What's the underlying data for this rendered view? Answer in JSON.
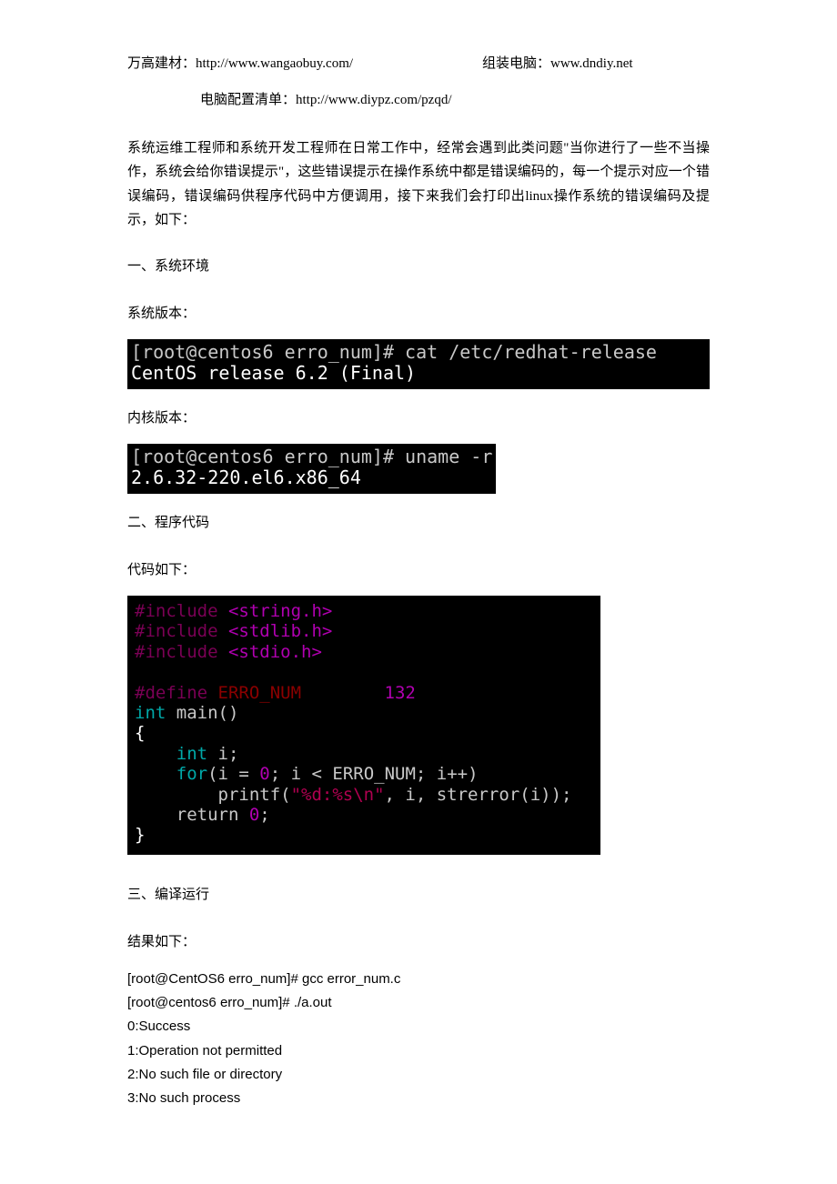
{
  "header": {
    "left": "万高建材：http://www.wangaobuy.com/",
    "right": "组装电脑：www.dndiy.net",
    "center": "电脑配置清单：http://www.diypz.com/pzqd/"
  },
  "intro": "系统运维工程师和系统开发工程师在日常工作中，经常会遇到此类问题\"当你进行了一些不当操作，系统会给你错误提示\"，这些错误提示在操作系统中都是错误编码的，每一个提示对应一个错误编码，错误编码供程序代码中方便调用，接下来我们会打印出linux操作系统的错误编码及提示，如下：",
  "sections": {
    "env": {
      "title": "一、系统环境",
      "sysVersion": "系统版本：",
      "kernelVersion": "内核版本："
    },
    "code": {
      "title": "二、程序代码",
      "label": "代码如下："
    },
    "compile": {
      "title": "三、编译运行",
      "label": "结果如下："
    }
  },
  "terminal1": {
    "line1": "[root@centos6 erro_num]# cat /etc/redhat-release",
    "line2": "CentOS release 6.2 (Final)"
  },
  "terminal2": {
    "line1": "[root@centos6 erro_num]# uname -r",
    "line2": "2.6.32-220.el6.x86_64"
  },
  "c_code": {
    "inc1": "#include",
    "h1": " <string.h>",
    "inc2": "#include",
    "h2": " <stdlib.h>",
    "inc3": "#include",
    "h3": " <stdio.h>",
    "def": "#define ",
    "macro": "ERRO_NUM",
    "macroval": "132",
    "int": "int",
    "main": " main()",
    "lbrace": "{",
    "int2": "int",
    "ivar": " i;",
    "for": "for",
    "forexpr": "(i = ",
    "zero1": "0",
    "forexpr2": "; i < ERRO_NUM; i++)",
    "printf": "printf(",
    "fmtstr": "\"%d:%s\\n\"",
    "printfargs": ", i, strerror(i));",
    "return": "return ",
    "zero2": "0",
    "semi": ";",
    "rbrace": "}"
  },
  "output": {
    "l1": "[root@CentOS6 erro_num]# gcc error_num.c",
    "l2": "[root@centos6 erro_num]# ./a.out",
    "l3": "0:Success",
    "l4": "1:Operation not permitted",
    "l5": "2:No such file or directory",
    "l6": "3:No such process"
  }
}
